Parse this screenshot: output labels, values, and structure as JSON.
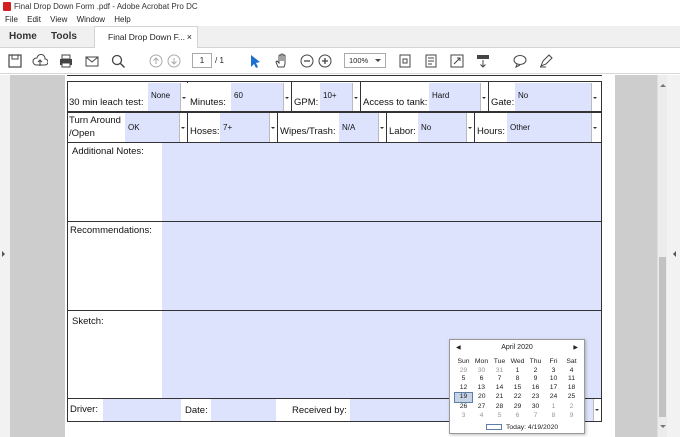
{
  "window": {
    "title": "Final Drop Down Form .pdf - Adobe Acrobat Pro DC"
  },
  "menu": [
    "File",
    "Edit",
    "View",
    "Window",
    "Help"
  ],
  "tabs": {
    "home": "Home",
    "tools": "Tools",
    "doc": "Final Drop Down F...",
    "close": "×"
  },
  "toolbar": {
    "page_current": "1",
    "page_total": "/ 1",
    "zoom": "100%"
  },
  "form": {
    "row1": {
      "leach_label": "30 min leach test:",
      "leach_value": "None",
      "minutes_label": "Minutes:",
      "minutes_value": "60",
      "gpm_label": "GPM:",
      "gpm_value": "10+",
      "access_label": "Access to tank:",
      "access_value": "Hard",
      "gate_label": "Gate:",
      "gate_value": "No"
    },
    "row2": {
      "turn_label_1": "Turn Around",
      "turn_label_2": "/Open",
      "turn_value": "OK",
      "hoses_label": "Hoses:",
      "hoses_value": "7+",
      "wipes_label": "Wipes/Trash:",
      "wipes_value": "N/A",
      "labor_label": "Labor:",
      "labor_value": "No",
      "hours_label": "Hours:",
      "hours_value": "Other"
    },
    "notes_label": "Additional Notes:",
    "recommendations_label": "Recommendations:",
    "sketch_label": "Sketch:",
    "driver_label": "Driver:",
    "date_label": "Date:",
    "received_label": "Received by:"
  },
  "calendar": {
    "month": "April 2020",
    "days": [
      "Sun",
      "Mon",
      "Tue",
      "Wed",
      "Thu",
      "Fri",
      "Sat"
    ],
    "weeks": [
      [
        "29",
        "30",
        "31",
        "1",
        "2",
        "3",
        "4"
      ],
      [
        "5",
        "6",
        "7",
        "8",
        "9",
        "10",
        "11"
      ],
      [
        "12",
        "13",
        "14",
        "15",
        "16",
        "17",
        "18"
      ],
      [
        "19",
        "20",
        "21",
        "22",
        "23",
        "24",
        "25"
      ],
      [
        "26",
        "27",
        "28",
        "29",
        "30",
        "1",
        "2"
      ],
      [
        "3",
        "4",
        "5",
        "6",
        "7",
        "8",
        "9"
      ]
    ],
    "today": "Today: 4/19/2020"
  }
}
